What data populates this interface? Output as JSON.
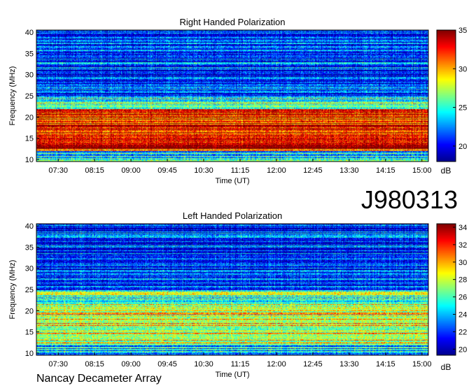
{
  "observation_id": "J980313",
  "instrument": "Nancay Decameter Array",
  "chart_data": [
    {
      "type": "heatmap",
      "title": "Right Handed Polarization",
      "xlabel": "Time (UT)",
      "ylabel": "Frequency (MHz)",
      "x_ticks": [
        "07:30",
        "08:15",
        "09:00",
        "09:45",
        "10:30",
        "11:15",
        "12:00",
        "12:45",
        "13:30",
        "14:15",
        "15:00"
      ],
      "y_ticks": [
        10,
        15,
        20,
        25,
        30,
        35,
        40
      ],
      "ylim": [
        9.5,
        40.5
      ],
      "xlim": [
        "07:03",
        "15:08"
      ],
      "colorbar": {
        "label": "dB",
        "ticks": [
          20,
          25,
          30,
          35
        ],
        "range": [
          18,
          35
        ]
      },
      "colormap": [
        "#00008f",
        "#0000ff",
        "#0080ff",
        "#00ffff",
        "#80ff80",
        "#ffff00",
        "#ff8000",
        "#ff0000",
        "#800000"
      ]
    },
    {
      "type": "heatmap",
      "title": "Left Handed Polarization",
      "xlabel": "Time (UT)",
      "ylabel": "Frequency (MHz)",
      "x_ticks": [
        "07:30",
        "08:15",
        "09:00",
        "09:45",
        "10:30",
        "11:15",
        "12:00",
        "12:45",
        "13:30",
        "14:15",
        "15:00"
      ],
      "y_ticks": [
        10,
        15,
        20,
        25,
        30,
        35,
        40
      ],
      "ylim": [
        9.5,
        40.5
      ],
      "xlim": [
        "07:03",
        "15:08"
      ],
      "colorbar": {
        "label": "dB",
        "ticks": [
          20,
          22,
          24,
          26,
          28,
          30,
          32,
          34
        ],
        "range": [
          19.3,
          34.4
        ]
      },
      "colormap": [
        "#00008f",
        "#0000ff",
        "#0080ff",
        "#00ffff",
        "#80ff80",
        "#ffff00",
        "#ff8000",
        "#ff0000",
        "#800000"
      ]
    }
  ]
}
